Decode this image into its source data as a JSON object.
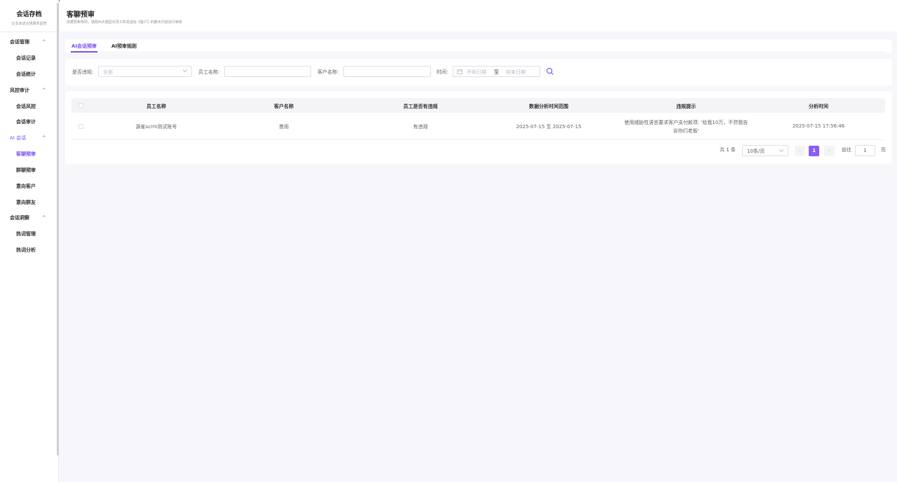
{
  "sidebar": {
    "title": "会话存档",
    "subtitle": "企业会话合规服务监管",
    "groups": [
      {
        "label": "会话管理",
        "items": [
          "会话记录",
          "会话统计"
        ]
      },
      {
        "label": "风控审计",
        "items": [
          "会话风控",
          "会话审计"
        ]
      },
      {
        "label": "AI 会话",
        "items": [
          "客聊预审",
          "群聊预审",
          "意向客户",
          "意向群友"
        ]
      },
      {
        "label": "会话洞察",
        "items": [
          "热词管理",
          "热词分析"
        ]
      }
    ],
    "chevron": "^"
  },
  "header": {
    "title": "客聊预审",
    "description": "依据预审规则，借助AI大模型对员工所发送给【客户】的聊天内容进行审核"
  },
  "tabs": [
    {
      "label": "AI会话预审"
    },
    {
      "label": "AI预审规则"
    }
  ],
  "filters": {
    "violation_label": "是否违规:",
    "violation_placeholder": "全部",
    "employee_label": "员工名称:",
    "customer_label": "客户名称:",
    "time_label": "时间:",
    "start_placeholder": "开始日期",
    "range_sep": "至",
    "end_placeholder": "结束日期"
  },
  "table": {
    "columns": [
      "员工名称",
      "客户名称",
      "员工是否有违规",
      "数据分析时间范围",
      "违规提示",
      "分析时间"
    ],
    "rows": [
      {
        "employee": "源雀scrm测试账号",
        "customer": "墨雨",
        "violation": "有违规",
        "range": "2025-07-15 至 2025-07-15",
        "hint": "使用威胁性语言要求客户支付款项: '给我10万，不然我告诉你们老板'",
        "time": "2025-07-15 17:56:46"
      }
    ]
  },
  "pagination": {
    "total": "共 1 条",
    "page_size": "10条/页",
    "prev": "‹",
    "current": "1",
    "next": "›",
    "goto_label": "前往",
    "goto_value": "1",
    "page_suffix": "页"
  },
  "colors": {
    "accent": "#7a4df0",
    "accent_button": "#8b5cf6",
    "top_bar": "#2f6fd1"
  },
  "icons": {
    "chevron": "chevron-up-icon",
    "select_arrow": "chevron-down-icon",
    "date": "calendar-icon",
    "search": "search-icon"
  }
}
